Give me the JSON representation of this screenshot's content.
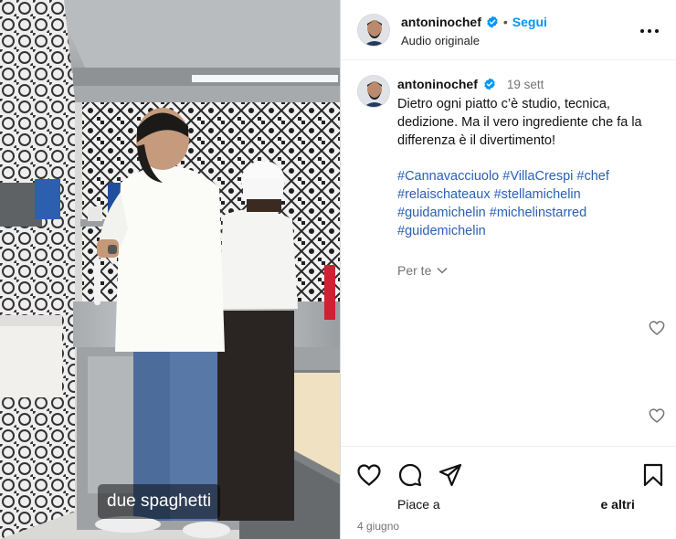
{
  "video": {
    "subtitle": "due spaghetti"
  },
  "header": {
    "username": "antoninochef",
    "separator": "•",
    "follow_label": "Segui",
    "audio_label": "Audio originale"
  },
  "comment": {
    "username": "antoninochef",
    "date": "19 sett",
    "text": "Dietro ogni piatto c’è studio, tecnica, dedizione. Ma il vero ingrediente che fa la differenza è il divertimento!",
    "hashtags": [
      "#Cannavacciuolo",
      "#VillaCrespi",
      "#chef",
      "#relaischateaux",
      "#stellamichelin",
      "#guidamichelin",
      "#michelinstarred",
      "#guidemichelin"
    ],
    "for_you_label": "Per te"
  },
  "actions": {
    "likes_prefix": "Piace a",
    "likes_suffix": "e altri",
    "post_date": "4 giugno"
  },
  "colors": {
    "accent": "#0095f6",
    "hashtag": "#2a5fb6",
    "muted": "#737373"
  },
  "icons": [
    "verified-badge-icon",
    "more-options-icon",
    "chevron-down-icon",
    "heart-icon",
    "comment-icon",
    "share-icon",
    "bookmark-icon"
  ]
}
